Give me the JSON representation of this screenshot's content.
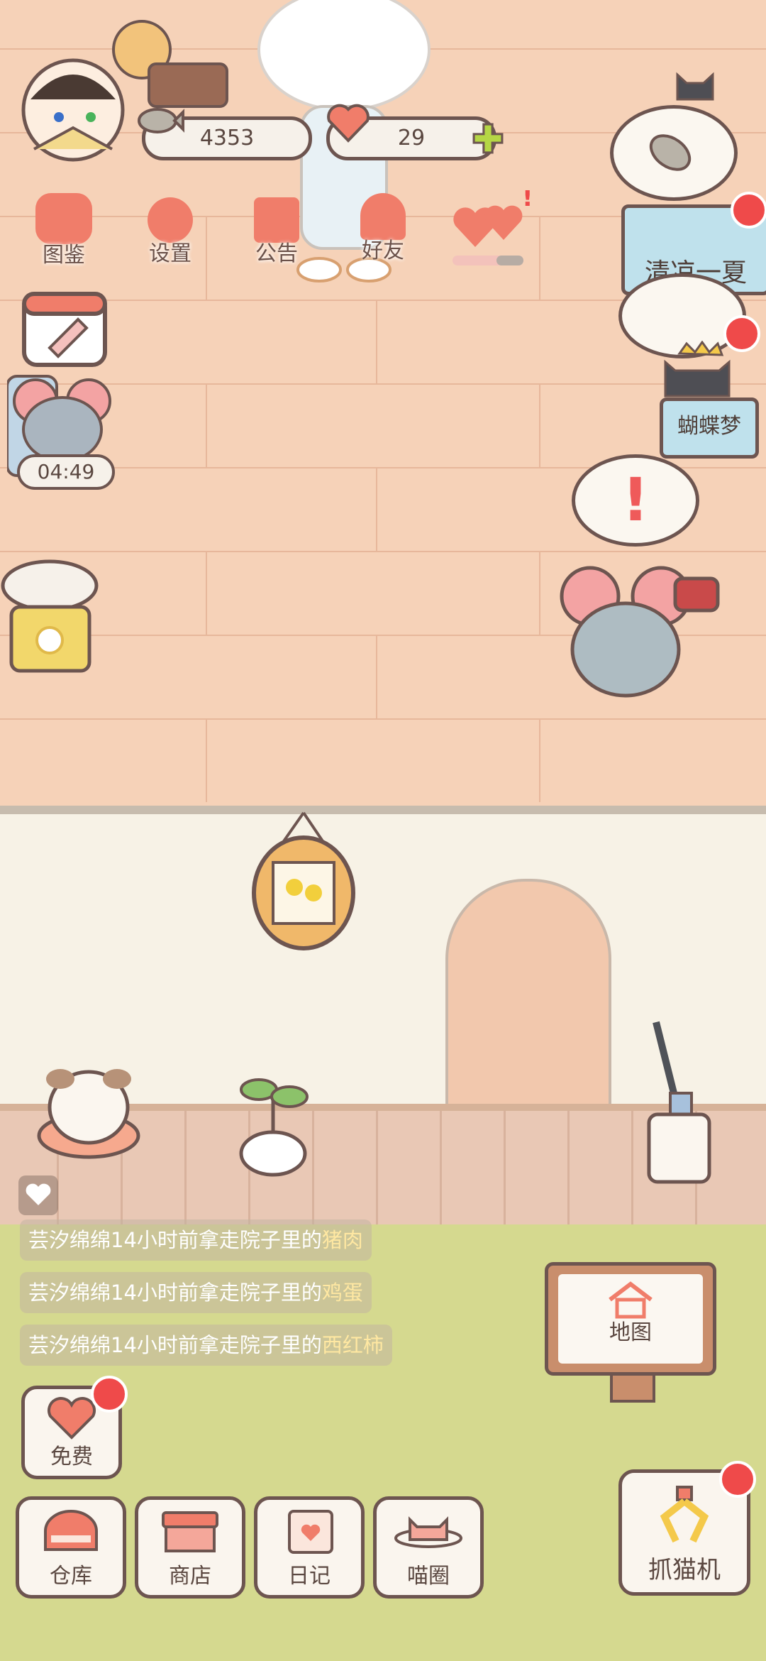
{
  "currency": {
    "fish_count": "4353",
    "heart_count": "29"
  },
  "top_menu": [
    {
      "label": "图鉴",
      "icon": "cat-book-icon"
    },
    {
      "label": "设置",
      "icon": "gear-icon"
    },
    {
      "label": "公告",
      "icon": "gift-icon"
    },
    {
      "label": "好友",
      "icon": "friends-icon"
    }
  ],
  "left_timer": "04:49",
  "events": {
    "summer_event": "清凉一夏",
    "butterfly_dream": "蝴蝶梦"
  },
  "activity_log": [
    {
      "actor": "芸汐绵绵",
      "time_text": "14小时前拿走院子里的",
      "item": "猪肉"
    },
    {
      "actor": "芸汐绵绵",
      "time_text": "14小时前拿走院子里的",
      "item": "鸡蛋"
    },
    {
      "actor": "芸汐绵绵",
      "time_text": "14小时前拿走院子里的",
      "item": "西红柿"
    }
  ],
  "map_button": "地图",
  "free_button": "免费",
  "bottom_nav": [
    {
      "label": "仓库",
      "icon": "warehouse-icon"
    },
    {
      "label": "商店",
      "icon": "shop-icon"
    },
    {
      "label": "日记",
      "icon": "diary-icon"
    },
    {
      "label": "喵圈",
      "icon": "cat-planet-icon"
    }
  ],
  "claw_machine": "抓猫机",
  "colors": {
    "accent": "#f07d6a",
    "outline": "#6d5550",
    "notification": "#ef4a4a",
    "wall": "#f6d2b8",
    "grass": "#d5d98f"
  }
}
